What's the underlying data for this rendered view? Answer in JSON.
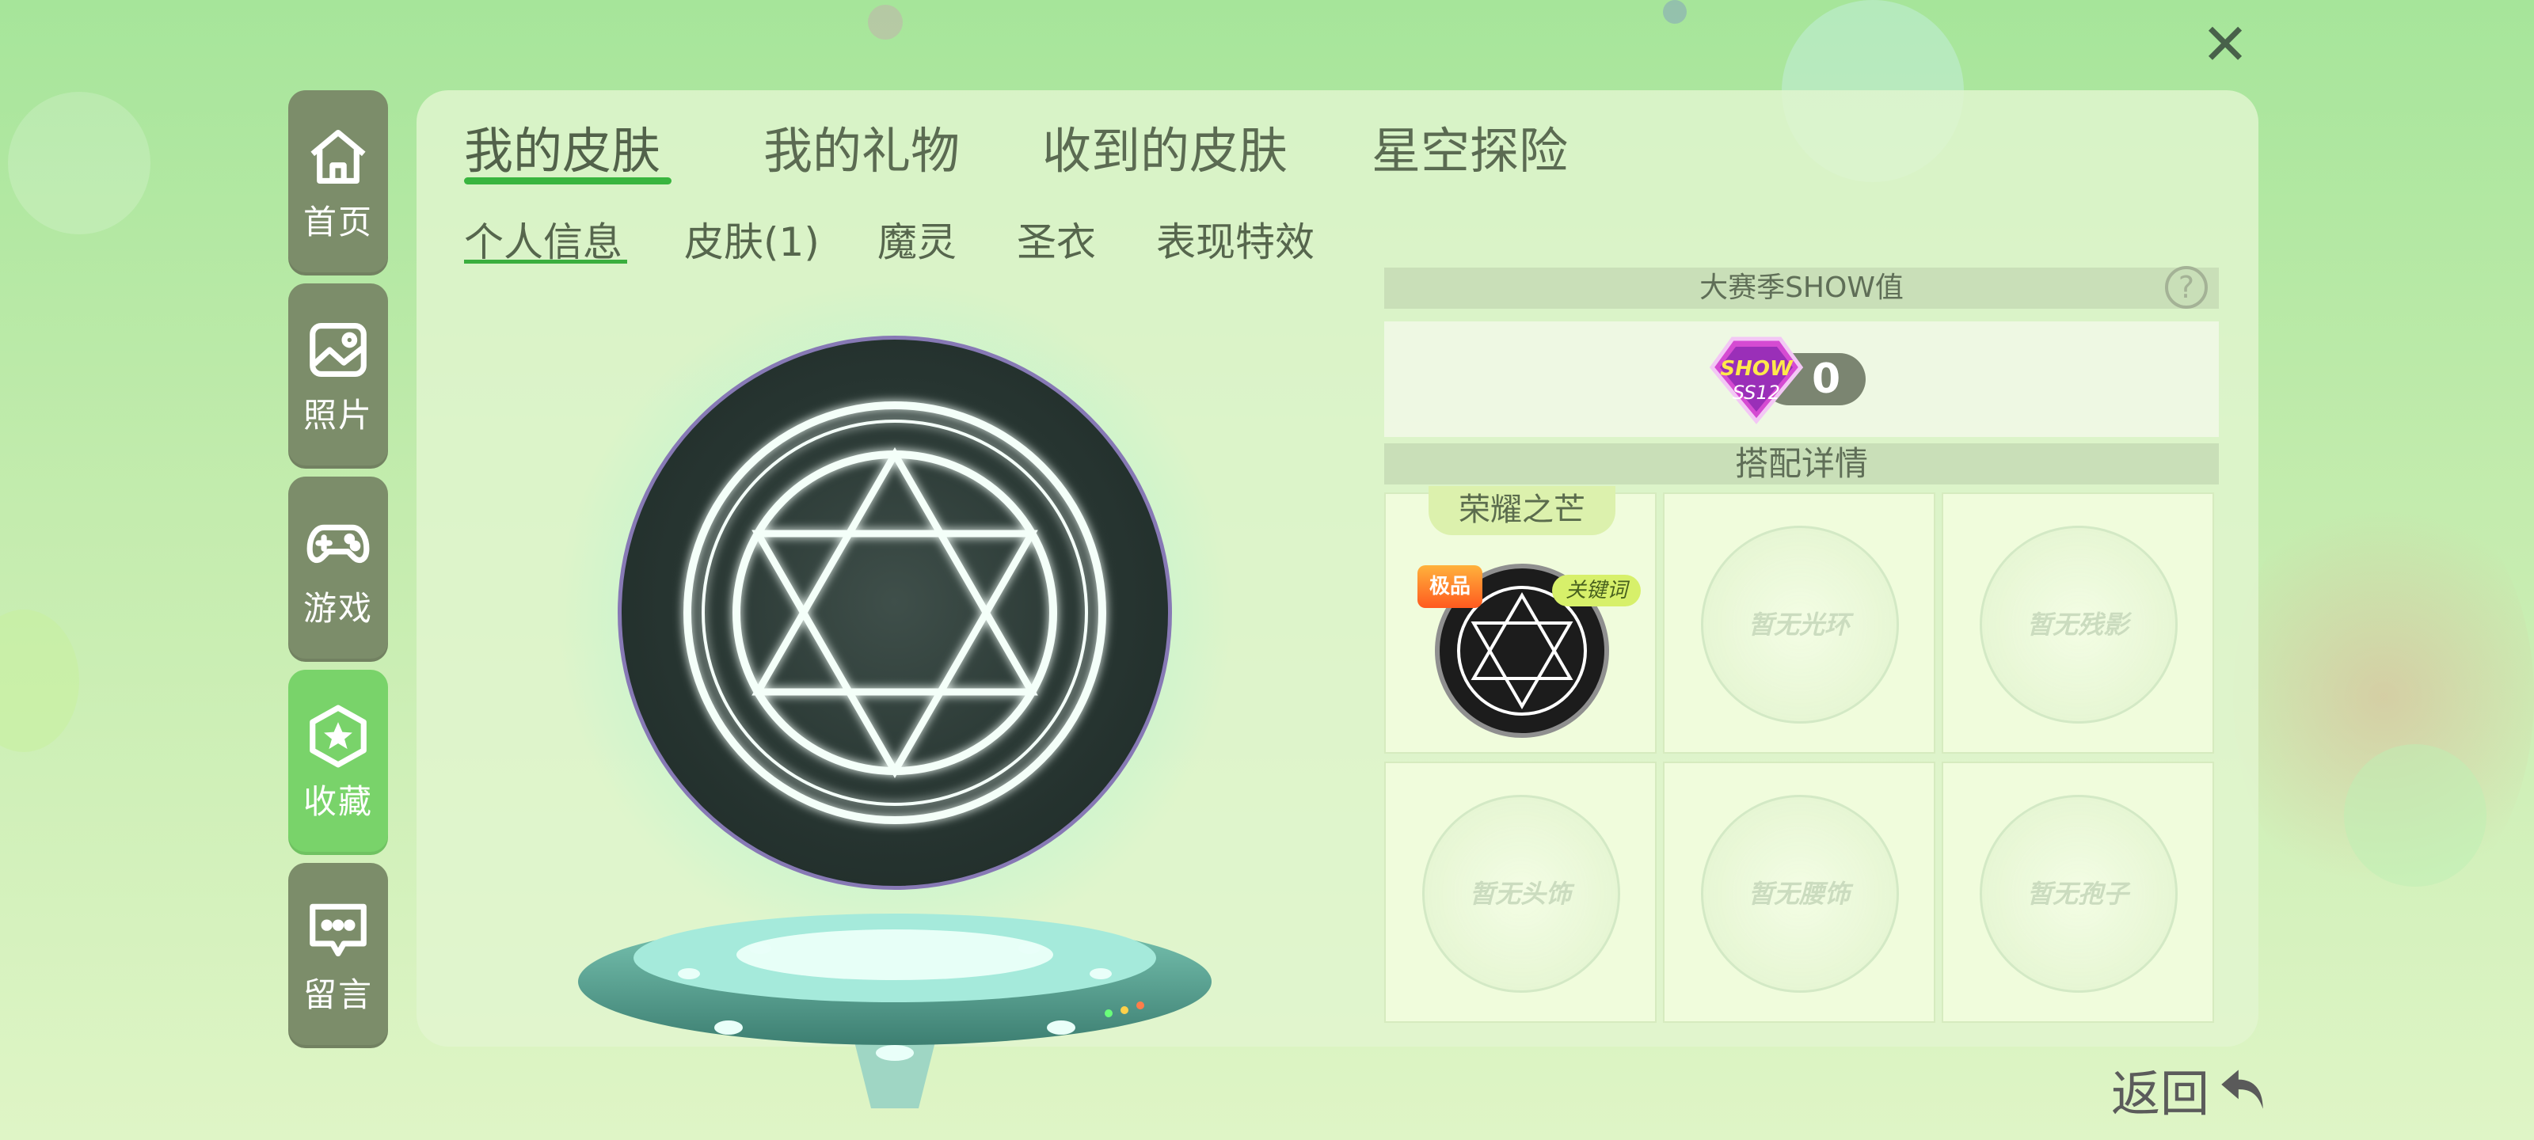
{
  "window": {
    "close_icon": "close-icon"
  },
  "sidebar": {
    "items": [
      {
        "label": "首页",
        "icon": "home-icon",
        "active": false
      },
      {
        "label": "照片",
        "icon": "photo-icon",
        "active": false
      },
      {
        "label": "游戏",
        "icon": "gamepad-icon",
        "active": false
      },
      {
        "label": "收藏",
        "icon": "star-badge-icon",
        "active": true
      },
      {
        "label": "留言",
        "icon": "message-icon",
        "active": false
      }
    ]
  },
  "tabs": {
    "top": [
      "我的皮肤",
      "我的礼物",
      "收到的皮肤",
      "星空探险"
    ],
    "top_active": "我的皮肤",
    "sub": [
      "个人信息",
      "皮肤(1)",
      "魔灵",
      "圣衣",
      "表现特效"
    ],
    "sub_active": "个人信息"
  },
  "show_section": {
    "title": "大赛季SHOW值",
    "help": "?",
    "badge_line1": "SHOW",
    "badge_line2": "SS12",
    "value": "0"
  },
  "outfit": {
    "title": "搭配详情",
    "equipped": {
      "name": "荣耀之芒",
      "rare_tag": "极品",
      "keyword_tag": "关键词"
    },
    "empty_slots": [
      "暂无光环",
      "暂无残影",
      "暂无头饰",
      "暂无腰饰",
      "暂无孢子"
    ]
  },
  "footer": {
    "return_label": "返回"
  },
  "colors": {
    "accent_green": "#39b53f",
    "sidebar_bg": "#7c8d6a",
    "sidebar_active": "#79d36a"
  }
}
